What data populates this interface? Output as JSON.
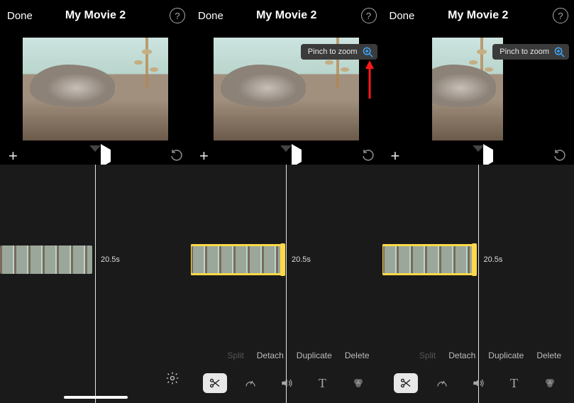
{
  "panels": [
    {
      "done": "Done",
      "title": "My Movie 2",
      "duration": "20.5s"
    },
    {
      "done": "Done",
      "title": "My Movie 2",
      "pinch_label": "Pinch to zoom",
      "duration": "20.5s",
      "actions": {
        "split": "Split",
        "detach": "Detach",
        "duplicate": "Duplicate",
        "delete": "Delete"
      }
    },
    {
      "done": "Done",
      "title": "My Movie 2",
      "pinch_label": "Pinch to zoom",
      "duration": "20.5s",
      "actions": {
        "split": "Split",
        "detach": "Detach",
        "duplicate": "Duplicate",
        "delete": "Delete"
      }
    }
  ]
}
